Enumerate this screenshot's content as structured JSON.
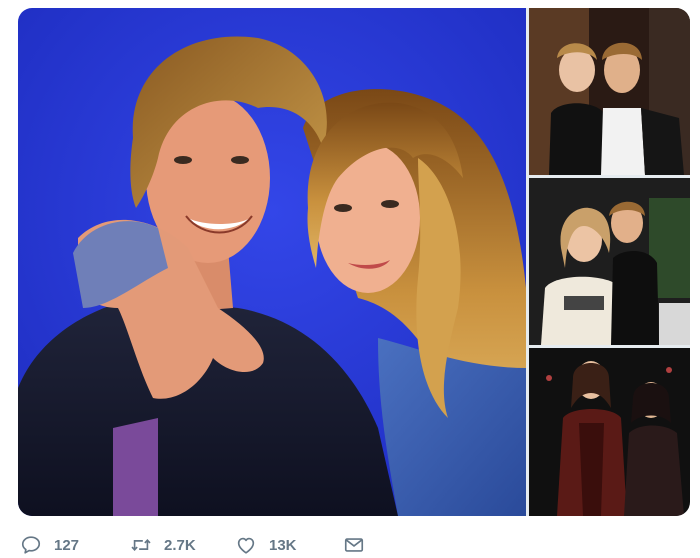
{
  "media": {
    "main_photo": {
      "subject": "couple-portrait"
    },
    "side_photos": [
      {
        "subject": "couple-candid"
      },
      {
        "subject": "couple-event"
      },
      {
        "subject": "couple-evening"
      }
    ]
  },
  "actions": {
    "reply": {
      "icon": "reply-icon",
      "count": "127"
    },
    "retweet": {
      "icon": "retweet-icon",
      "count": "2.7K"
    },
    "like": {
      "icon": "heart-icon",
      "count": "13K"
    },
    "message": {
      "icon": "envelope-icon"
    }
  },
  "colors": {
    "backdrop_blue": "#2a3bd6",
    "action_gray": "#657786"
  }
}
